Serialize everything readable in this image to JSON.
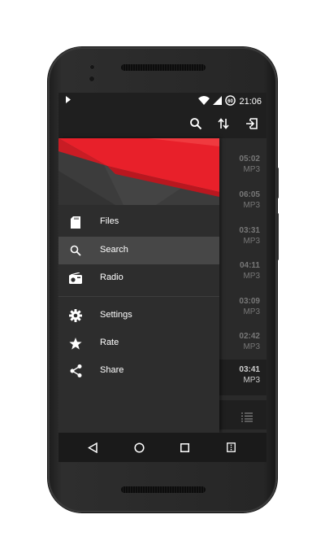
{
  "status_bar": {
    "time": "21:06",
    "play_indicator_icon": "play-icon",
    "battery_level_text": "60"
  },
  "app_bar": {
    "actions": [
      "search-icon",
      "sort-icon",
      "exit-icon"
    ]
  },
  "drawer": {
    "items": [
      {
        "label": "Files",
        "icon": "sd-card-icon"
      },
      {
        "label": "Search",
        "icon": "search-icon",
        "selected": true
      },
      {
        "label": "Radio",
        "icon": "radio-icon"
      },
      {
        "label": "Settings",
        "icon": "gear-icon"
      },
      {
        "label": "Rate",
        "icon": "star-icon"
      },
      {
        "label": "Share",
        "icon": "share-icon"
      }
    ]
  },
  "tracks": [
    {
      "duration": "05:02",
      "format": "MP3"
    },
    {
      "duration": "06:05",
      "format": "MP3"
    },
    {
      "duration": "03:31",
      "format": "MP3"
    },
    {
      "duration": "04:11",
      "format": "MP3"
    },
    {
      "duration": "03:09",
      "format": "MP3"
    },
    {
      "duration": "02:42",
      "format": "MP3"
    },
    {
      "duration": "03:41",
      "format": "MP3"
    }
  ],
  "colors": {
    "accent": "#e8202a",
    "background": "#2d2d2d",
    "toolbar": "#1f1f1f"
  }
}
